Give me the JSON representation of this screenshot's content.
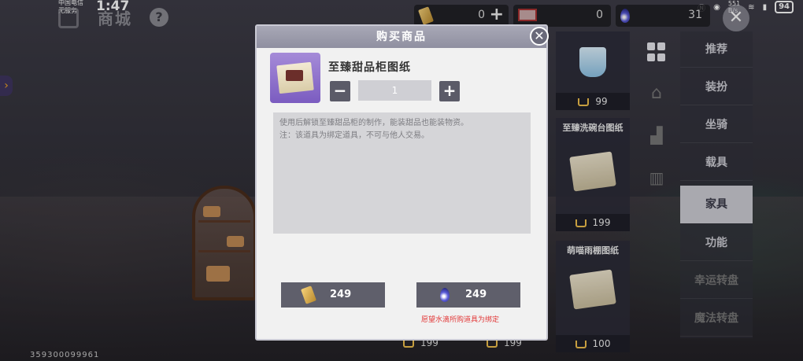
{
  "status_bar": {
    "carrier_line1": "中国电信",
    "carrier_line2": "无服务",
    "time": "1:47",
    "net_speed_top": "551",
    "net_speed_unit": "B/s",
    "battery": "94"
  },
  "header": {
    "title": "商城",
    "help_label": "?",
    "currency_gold": "0",
    "currency_ticket": "0",
    "currency_gem": "31"
  },
  "category_nav": {
    "items": [
      {
        "label": "推荐",
        "active": false
      },
      {
        "label": "装扮",
        "active": false
      },
      {
        "label": "坐骑",
        "active": false
      },
      {
        "label": "载具",
        "active": false
      },
      {
        "label": "家具",
        "active": true
      },
      {
        "label": "功能",
        "active": false
      },
      {
        "label": "幸运转盘",
        "active": false
      },
      {
        "label": "魔法转盘",
        "active": false
      }
    ]
  },
  "product_cards": [
    {
      "name": "",
      "price": "99"
    },
    {
      "name": "至臻洗碗台图纸",
      "price": "199"
    },
    {
      "name": "萌喵雨棚图纸",
      "price": "100"
    }
  ],
  "bottom_prices": [
    "199",
    "199"
  ],
  "footer_id": "359300099961",
  "modal": {
    "title": "购买商品",
    "close_label": "✕",
    "item_name": "至臻甜品柜图纸",
    "quantity": "1",
    "minus_label": "−",
    "plus_label": "+",
    "description_lines": [
      "使用后解锁至臻甜品柜的制作，能装甜品也能装物资。",
      "注：该道具为绑定道具，不可与他人交易。"
    ],
    "buy_gold_price": "249",
    "buy_gem_price": "249",
    "notice": "愿望水滴所购道具为绑定"
  },
  "colors": {
    "modal_bg": "#f1f1f1",
    "button_bg": "#5f5f6b",
    "active_tab": "#cfcfd6",
    "notice_red": "#e23a3a",
    "price_cart": "#f2c14e"
  }
}
